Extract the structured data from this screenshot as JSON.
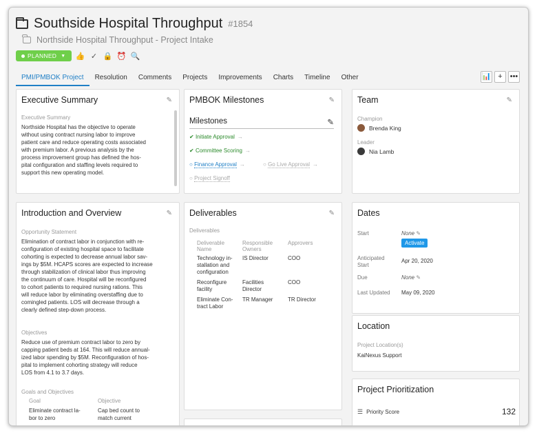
{
  "header": {
    "title": "Southside Hospital Throughput",
    "number": "#1854",
    "parent": "Northside Hospital Throughput - Project Intake",
    "status": "PLANNED"
  },
  "tabs": [
    {
      "label": "PMI/PMBOK Project"
    },
    {
      "label": "Resolution"
    },
    {
      "label": "Comments"
    },
    {
      "label": "Projects"
    },
    {
      "label": "Improvements"
    },
    {
      "label": "Charts"
    },
    {
      "label": "Timeline"
    },
    {
      "label": "Other"
    }
  ],
  "exec": {
    "title": "Executive Summary",
    "label": "Executive Summary",
    "lines": [
      "Northside Hospital has the objective to operate",
      "without using contract nursing labor to improve",
      "patient care and reduce operating costs associated",
      "with premium labor. A previous analysis by the",
      "process improvement group has defined the hos-",
      "pital configuration and staffing levels required to",
      "support this new operating model."
    ]
  },
  "milestones": {
    "title": "PMBOK Milestones",
    "heading": "Milestones",
    "items": [
      "Initiate Approval",
      "Committee Scoring",
      "Finance Approval",
      "Go Live Approval",
      "Project Signoff"
    ]
  },
  "team": {
    "title": "Team",
    "champion_label": "Champion",
    "champion": "Brenda King",
    "leader_label": "Leader",
    "leader": "Nia Lamb"
  },
  "intro": {
    "title": "Introduction and Overview",
    "opp_label": "Opportunity Statement",
    "opp_lines": [
      "Elimination of contract labor in conjunction with re-",
      "configuration of existing hospital space to facilitate",
      "cohorting is expected to decrease annual labor sav-",
      "ings by $5M. HCAPS scores are expected to increase",
      "through stabilization of clinical labor thus improving",
      "the continuum of care. Hospital will be reconfigured",
      "to cohort patients to required nursing rations. This",
      "will reduce labor by eliminating overstaffing due to",
      "comingled patients. LOS will decrease through a",
      "clearly defined step-down process."
    ],
    "obj_label": "Objectives",
    "obj_lines": [
      "Reduce use of premium contract labor to zero by",
      "capping patient beds at 164. This will reduce annual-",
      "ized labor spending by $5M. Reconfiguration of hos-",
      "pital to implement cohorting strategy will reduce",
      "LOS from 4.1 to 3.7 days."
    ],
    "goals_label": "Goals and Objectives",
    "goal_col": "Goal",
    "objective_col": "Objective",
    "goal_lines": [
      "Eliminate contract la-",
      "bor to zero"
    ],
    "objective_lines": [
      "Cap bed count to",
      "match current"
    ]
  },
  "deliverables": {
    "title": "Deliverables",
    "label": "Deliverables",
    "col1": [
      "Deliverable",
      "Name"
    ],
    "col2": [
      "Responsible",
      "Owners"
    ],
    "col3": "Approvers",
    "rows": [
      {
        "name": [
          "Technology in-",
          "stallation and",
          "configuration"
        ],
        "owner": [
          "IS Director"
        ],
        "approver": "COO"
      },
      {
        "name": [
          "Reconfigure",
          "facility"
        ],
        "owner": [
          "Facilities",
          "Director"
        ],
        "approver": "COO"
      },
      {
        "name": [
          "Eliminate Con-",
          "tract Labor"
        ],
        "owner": [
          "TR Manager"
        ],
        "approver": "TR Director"
      }
    ]
  },
  "dates": {
    "title": "Dates",
    "start_label": "Start",
    "start_value": "None",
    "activate": "Activate",
    "anticipated_label": [
      "Anticipated",
      "Start"
    ],
    "anticipated_value": "Apr 20, 2020",
    "due_label": "Due",
    "due_value": "None",
    "updated_label": "Last Updated",
    "updated_value": "May 09, 2020"
  },
  "location": {
    "title": "Location",
    "label": "Project Location(s)",
    "value": "KaiNexus Support"
  },
  "prioritization": {
    "title": "Project Prioritization",
    "score_label": "Priority Score",
    "score": "132"
  }
}
